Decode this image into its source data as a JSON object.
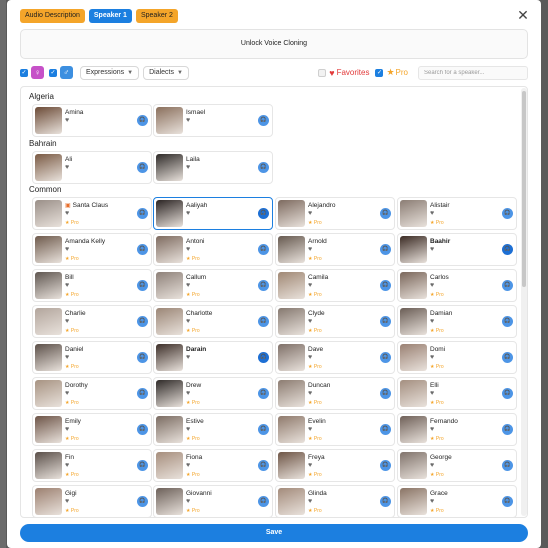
{
  "colors": {
    "accent": "#1c7fe0",
    "pro": "#f4a52a",
    "favorite": "#e23b3b"
  },
  "tabs": [
    {
      "label": "Audio Description",
      "style": "orange"
    },
    {
      "label": "Speaker 1",
      "style": "blue"
    },
    {
      "label": "Speaker 2",
      "style": "orange"
    }
  ],
  "close_icon": "close-icon",
  "unlock_text": "Unlock Voice Cloning",
  "filters": {
    "expressions_label": "Expressions",
    "dialects_label": "Dialects",
    "favorites_label": "Favorites",
    "pro_label": "Pro",
    "search_placeholder": "Search for a speaker..."
  },
  "pro_tag": "Pro",
  "sections": [
    {
      "title": "Algeria",
      "speakers": [
        {
          "name": "Amina",
          "pro": false,
          "selected": false,
          "bold": false,
          "tone": "#6b4a36"
        },
        {
          "name": "Ismael",
          "pro": false,
          "selected": false,
          "bold": false,
          "tone": "#8a6f5c"
        }
      ]
    },
    {
      "title": "Bahrain",
      "speakers": [
        {
          "name": "Ali",
          "pro": false,
          "selected": false,
          "bold": false,
          "tone": "#7a5a44"
        },
        {
          "name": "Laila",
          "pro": false,
          "selected": false,
          "bold": false,
          "tone": "#2e2a28"
        }
      ]
    },
    {
      "title": "Common",
      "speakers": [
        {
          "name": "Santa Claus",
          "pro": true,
          "selected": false,
          "bold": false,
          "tone": "#9a8f88",
          "calendar": true
        },
        {
          "name": "Aaliyah",
          "pro": false,
          "selected": true,
          "bold": false,
          "tone": "#2a2322"
        },
        {
          "name": "Alejandro",
          "pro": true,
          "selected": false,
          "bold": false,
          "tone": "#7d6a5f"
        },
        {
          "name": "Alistair",
          "pro": true,
          "selected": false,
          "bold": false,
          "tone": "#8b7d74"
        },
        {
          "name": "Amanda Kelly",
          "pro": true,
          "selected": false,
          "bold": false,
          "tone": "#6e5a4c"
        },
        {
          "name": "Antoni",
          "pro": true,
          "selected": false,
          "bold": false,
          "tone": "#7e6b60"
        },
        {
          "name": "Arnold",
          "pro": true,
          "selected": false,
          "bold": false,
          "tone": "#66594f"
        },
        {
          "name": "Baahir",
          "pro": false,
          "selected": false,
          "bold": true,
          "tone": "#3b2b24"
        },
        {
          "name": "Bill",
          "pro": true,
          "selected": false,
          "bold": false,
          "tone": "#5f5650"
        },
        {
          "name": "Callum",
          "pro": true,
          "selected": false,
          "bold": false,
          "tone": "#8e8179"
        },
        {
          "name": "Camila",
          "pro": true,
          "selected": false,
          "bold": false,
          "tone": "#a08874"
        },
        {
          "name": "Carlos",
          "pro": true,
          "selected": false,
          "bold": false,
          "tone": "#7a665a"
        },
        {
          "name": "Charlie",
          "pro": true,
          "selected": false,
          "bold": false,
          "tone": "#b2a59c"
        },
        {
          "name": "Charlotte",
          "pro": true,
          "selected": false,
          "bold": false,
          "tone": "#9b8676"
        },
        {
          "name": "Clyde",
          "pro": true,
          "selected": false,
          "bold": false,
          "tone": "#85786f"
        },
        {
          "name": "Damian",
          "pro": true,
          "selected": false,
          "bold": false,
          "tone": "#6a5d55"
        },
        {
          "name": "Daniel",
          "pro": true,
          "selected": false,
          "bold": false,
          "tone": "#5c5049"
        },
        {
          "name": "Darain",
          "pro": false,
          "selected": false,
          "bold": true,
          "tone": "#3d2f29"
        },
        {
          "name": "Dave",
          "pro": true,
          "selected": false,
          "bold": false,
          "tone": "#7f7068"
        },
        {
          "name": "Domi",
          "pro": true,
          "selected": false,
          "bold": false,
          "tone": "#9a8173"
        },
        {
          "name": "Dorothy",
          "pro": true,
          "selected": false,
          "bold": false,
          "tone": "#a79382"
        },
        {
          "name": "Drew",
          "pro": true,
          "selected": false,
          "bold": false,
          "tone": "#2f2a28"
        },
        {
          "name": "Duncan",
          "pro": true,
          "selected": false,
          "bold": false,
          "tone": "#8c7c71"
        },
        {
          "name": "Elli",
          "pro": true,
          "selected": false,
          "bold": false,
          "tone": "#a48f80"
        },
        {
          "name": "Emily",
          "pro": true,
          "selected": false,
          "bold": false,
          "tone": "#6d5447"
        },
        {
          "name": "Estive",
          "pro": true,
          "selected": false,
          "bold": false,
          "tone": "#7b6c62"
        },
        {
          "name": "Evelin",
          "pro": true,
          "selected": false,
          "bold": false,
          "tone": "#8f7a6c"
        },
        {
          "name": "Fernando",
          "pro": true,
          "selected": false,
          "bold": false,
          "tone": "#6f6058"
        },
        {
          "name": "Fin",
          "pro": true,
          "selected": false,
          "bold": false,
          "tone": "#5a4f49"
        },
        {
          "name": "Fiona",
          "pro": true,
          "selected": false,
          "bold": false,
          "tone": "#a68e7d"
        },
        {
          "name": "Freya",
          "pro": true,
          "selected": false,
          "bold": false,
          "tone": "#6e5546"
        },
        {
          "name": "George",
          "pro": true,
          "selected": false,
          "bold": false,
          "tone": "#80736b"
        },
        {
          "name": "Gigi",
          "pro": true,
          "selected": false,
          "bold": false,
          "tone": "#9c8070"
        },
        {
          "name": "Giovanni",
          "pro": true,
          "selected": false,
          "bold": false,
          "tone": "#6c6059"
        },
        {
          "name": "Glinda",
          "pro": true,
          "selected": false,
          "bold": false,
          "tone": "#a38b7b"
        },
        {
          "name": "Grace",
          "pro": true,
          "selected": false,
          "bold": false,
          "tone": "#8a7465"
        }
      ]
    }
  ],
  "save_label": "Save"
}
